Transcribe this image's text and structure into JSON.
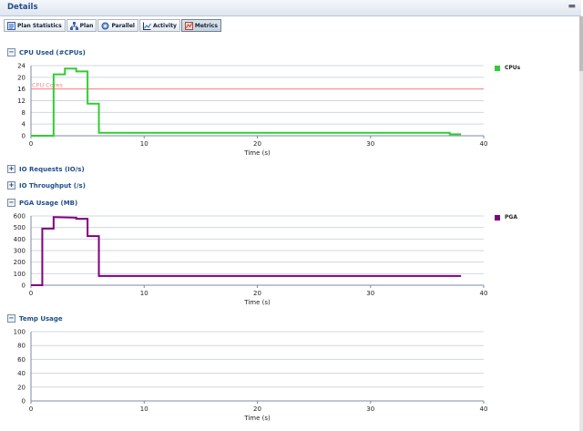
{
  "header": {
    "title": "Details",
    "collapse_icon": "collapse-icon"
  },
  "toolbar": {
    "buttons": [
      {
        "label": "Plan Statistics",
        "icon": "statistics-icon",
        "active": false
      },
      {
        "label": "Plan",
        "icon": "plan-tree-icon",
        "active": false
      },
      {
        "label": "Parallel",
        "icon": "parallel-icon",
        "active": false
      },
      {
        "label": "Activity",
        "icon": "activity-chart-icon",
        "active": false
      },
      {
        "label": "Metrics",
        "icon": "metrics-icon",
        "active": true
      }
    ]
  },
  "sections": {
    "cpu": {
      "label": "CPU Used  (#CPUs)",
      "toggle": "−"
    },
    "io_requests": {
      "label": "IO Requests  (IO/s)",
      "toggle": "+"
    },
    "io_throughput": {
      "label": "IO Throughput  (/s)",
      "toggle": "+"
    },
    "pga": {
      "label": "PGA Usage  (MB)",
      "toggle": "−"
    },
    "temp": {
      "label": "Temp Usage",
      "toggle": "−"
    }
  },
  "chart_data": [
    {
      "type": "line",
      "id": "cpu",
      "xlabel": "Time (s)",
      "xlim": [
        0,
        40
      ],
      "ylim": [
        0,
        24
      ],
      "xticks": [
        0,
        10,
        20,
        30,
        40
      ],
      "yticks": [
        0,
        4,
        8,
        12,
        16,
        20,
        24
      ],
      "grid": true,
      "legend_placement": "right",
      "series": [
        {
          "name": "CPUs",
          "color": "#33cc33",
          "x": [
            0,
            2,
            2,
            3,
            3,
            4,
            4,
            5,
            5,
            6,
            6,
            7,
            7,
            37,
            37,
            38
          ],
          "y": [
            0,
            0,
            21,
            21,
            23,
            23,
            22,
            22,
            11,
            11,
            1,
            1,
            1,
            1,
            0.5,
            0.5
          ]
        }
      ],
      "reference_line": {
        "label": "CPU Cores",
        "y": 16,
        "color": "#ff8080"
      }
    },
    {
      "type": "line",
      "id": "pga",
      "xlabel": "Time (s)",
      "xlim": [
        0,
        40
      ],
      "ylim": [
        0,
        600
      ],
      "xticks": [
        0,
        10,
        20,
        30,
        40
      ],
      "yticks": [
        0,
        100,
        200,
        300,
        400,
        500,
        600
      ],
      "grid": true,
      "legend_placement": "right",
      "series": [
        {
          "name": "PGA",
          "color": "#800080",
          "x": [
            0,
            1,
            1,
            2,
            2,
            4,
            4,
            5,
            5,
            6,
            6,
            38
          ],
          "y": [
            0,
            0,
            490,
            490,
            590,
            585,
            575,
            575,
            425,
            425,
            80,
            80
          ]
        }
      ]
    },
    {
      "type": "line",
      "id": "temp",
      "xlabel": "Time (s)",
      "xlim": [
        0,
        40
      ],
      "ylim": [
        0,
        100
      ],
      "xticks": [
        0,
        10,
        20,
        30,
        40
      ],
      "yticks": [
        0,
        20,
        40,
        60,
        80,
        100
      ],
      "grid": true,
      "series": []
    }
  ]
}
